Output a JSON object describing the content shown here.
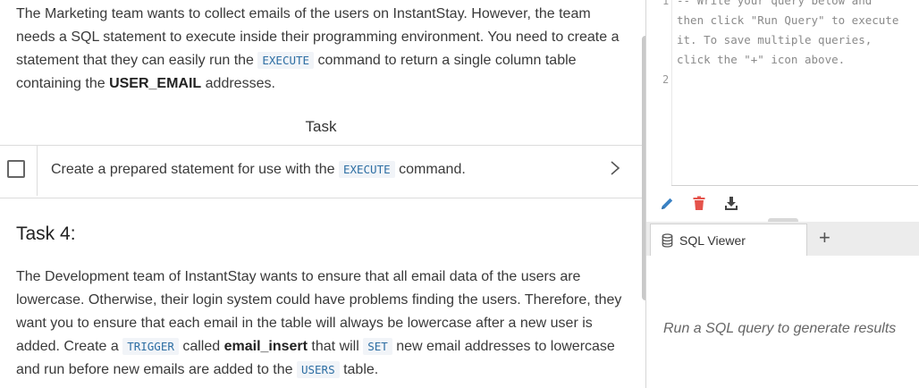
{
  "left": {
    "task3": {
      "p1_a": "The Marketing team wants to collect emails of the users on InstantStay. However, the team needs a SQL statement to execute inside their programming environment. You need to create a statement that they can easily run the ",
      "p1_code": "EXECUTE",
      "p1_b": " command to return a single column table containing the ",
      "p1_bold": "USER_EMAIL",
      "p1_c": " addresses.",
      "task_header": "Task",
      "task_a": "Create a prepared statement for use with the ",
      "task_code": "EXECUTE",
      "task_b": " command."
    },
    "task4": {
      "heading": "Task 4:",
      "p_a": "The Development team of InstantStay wants to ensure that all email data of the users are lowercase. Otherwise, their login system could have problems finding the users. Therefore, they want you to ensure that each email in the table will always be lowercase after a new user is added. Create a ",
      "code1": "TRIGGER",
      "p_b": " called ",
      "bold1": "email_insert",
      "p_c": " that will ",
      "code2": "SET",
      "p_d": " new email addresses to lowercase and run before new emails are added to the ",
      "code3": "USERS",
      "p_e": " table."
    }
  },
  "editor": {
    "line1_no": "1",
    "line2_no": "2",
    "comment_1": "-- Write your query below and",
    "comment_2": "then click \"Run Query\" to execute",
    "comment_3": "it. To save multiple queries,",
    "comment_4": "click the \"+\" icon above."
  },
  "toolbar": {
    "icons": [
      "pencil-icon",
      "trash-icon",
      "download-icon"
    ],
    "colors": {
      "pencil": "#3b82c4",
      "trash": "#e5534b",
      "download": "#444444"
    }
  },
  "results": {
    "tab_label": "SQL Viewer",
    "add_tab": "+",
    "empty_message": "Run a SQL query to generate results"
  }
}
